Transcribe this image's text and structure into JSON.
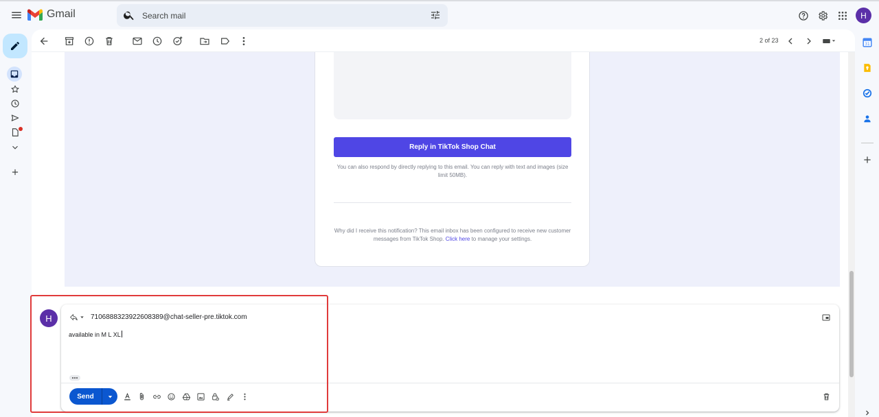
{
  "header": {
    "app_name": "Gmail",
    "search_placeholder": "Search mail",
    "account_initial": "H"
  },
  "toolbar": {
    "pagination": "2 of 23"
  },
  "email": {
    "reply_button_label": "Reply in TikTok Shop Chat",
    "reply_note": "You can also respond by directly replying to this email. You can reply with text and images (size limit 50MB).",
    "footer_text": "Why did I receive this notification? This email inbox has been configured to receive new customer messages from TikTok Shop.",
    "footer_link": "Click here",
    "footer_suffix": "to manage your settings."
  },
  "reply": {
    "avatar_initial": "H",
    "recipient": "7106888323922608389@chat-seller-pre.tiktok.com",
    "body": "available in M L XL",
    "send_label": "Send"
  },
  "colors": {
    "accent": "#0b57d0",
    "tiktok_button": "#4f46e5",
    "highlight": "#e03a3a",
    "avatar": "#5b2fa8"
  }
}
